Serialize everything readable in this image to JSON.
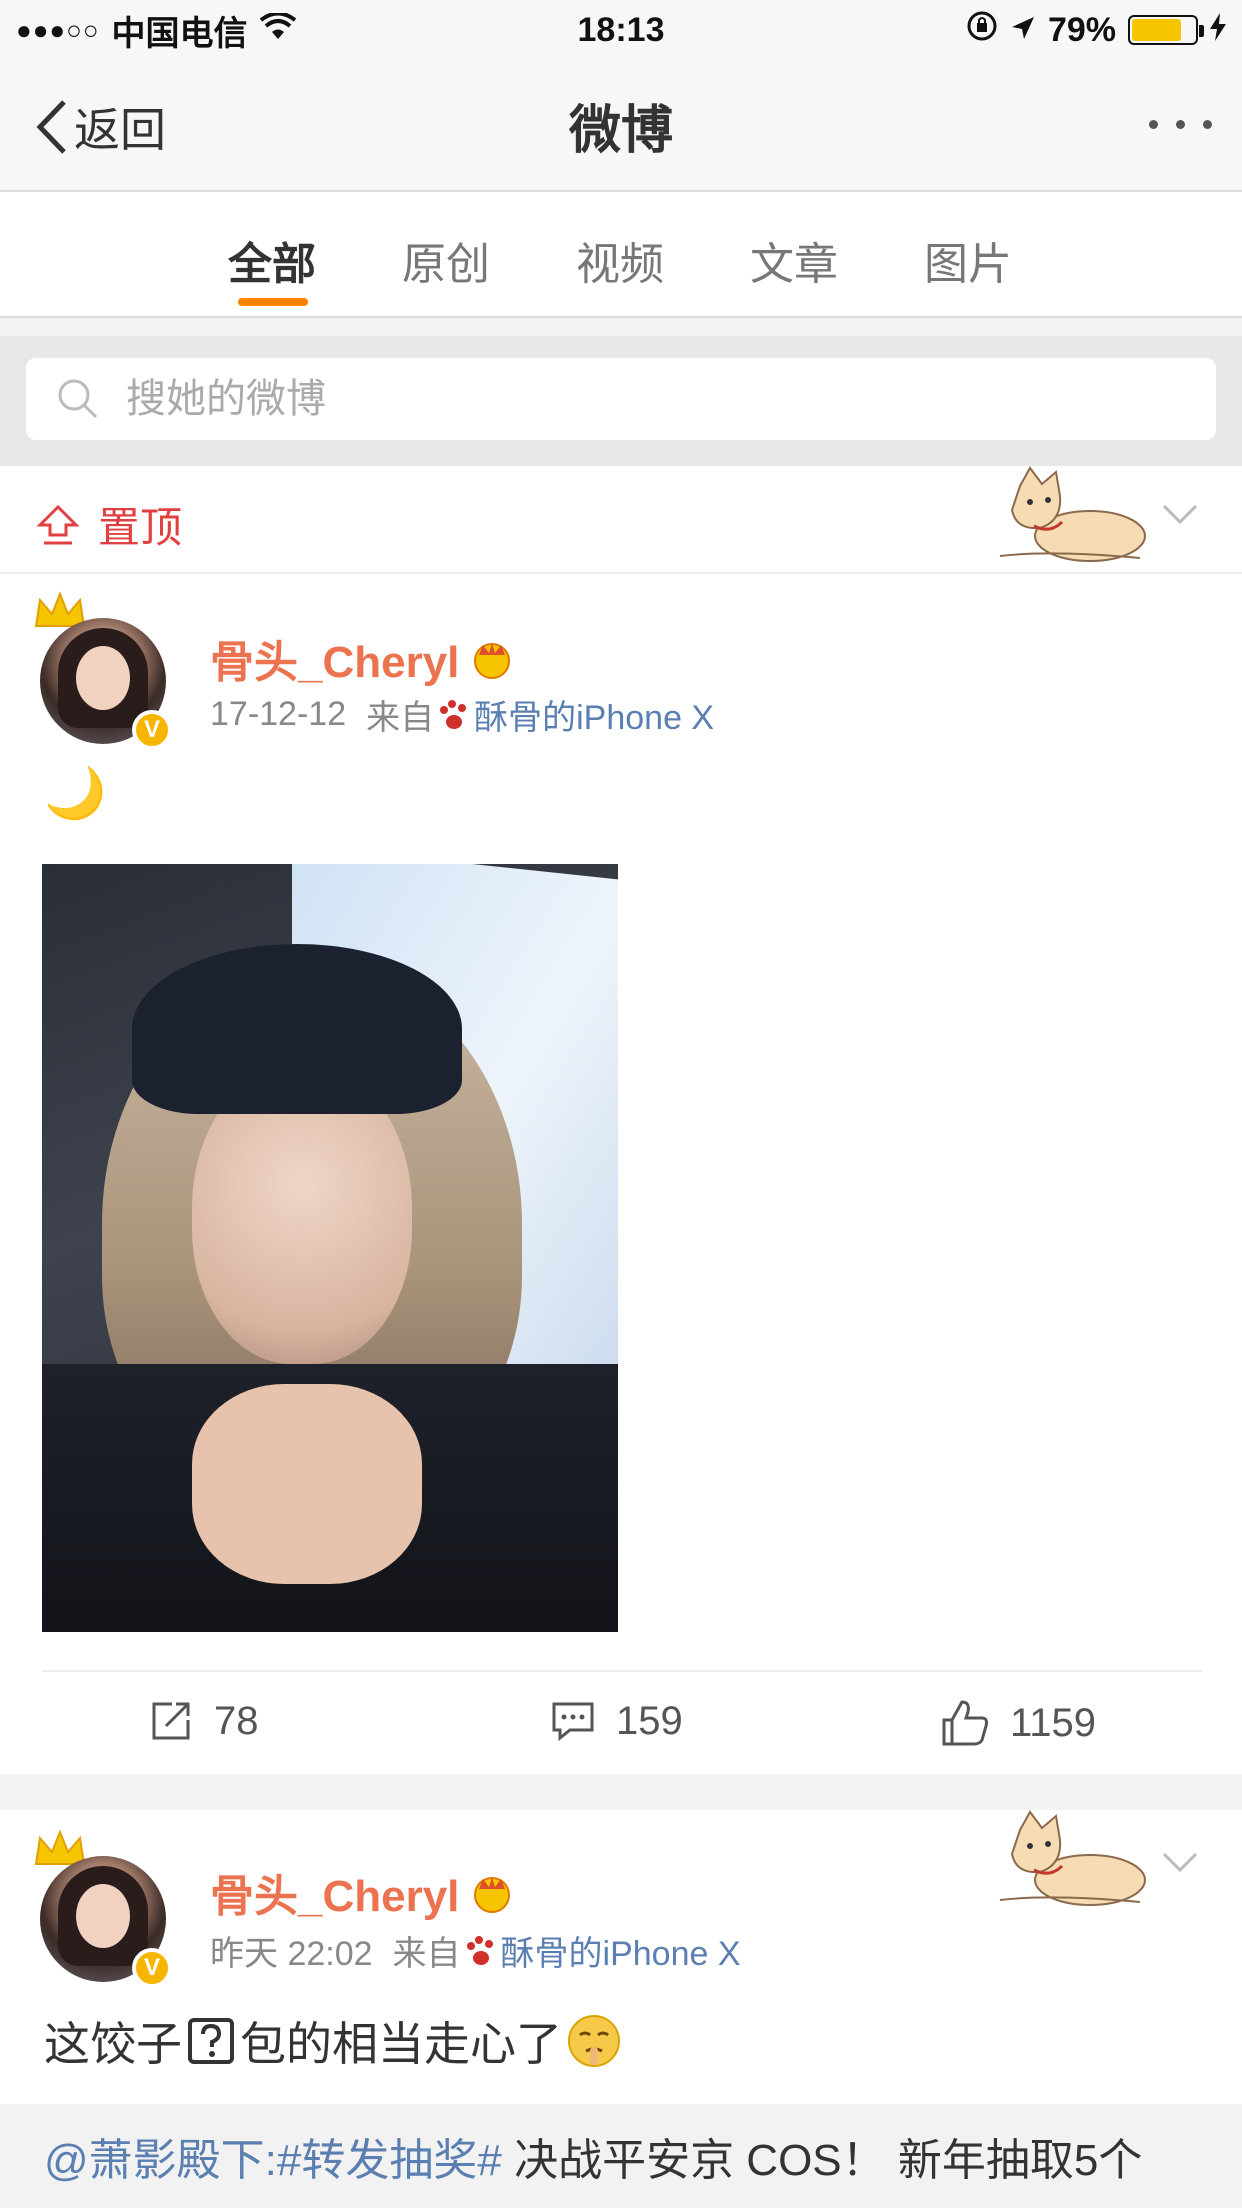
{
  "status_bar": {
    "signal": "●●●○○",
    "carrier": "中国电信",
    "time": "18:13",
    "battery": "79%",
    "battery_level": 0.79
  },
  "nav": {
    "back_label": "返回",
    "title": "微博"
  },
  "tabs": [
    {
      "label": "全部",
      "active": true
    },
    {
      "label": "原创",
      "active": false
    },
    {
      "label": "视频",
      "active": false
    },
    {
      "label": "文章",
      "active": false
    },
    {
      "label": "图片",
      "active": false
    }
  ],
  "search": {
    "placeholder": "搜她的微博"
  },
  "pinned": {
    "label": "置顶"
  },
  "posts": [
    {
      "user": "骨头_Cheryl",
      "date": "17-12-12",
      "source_prefix": "来自",
      "device": "酥骨的iPhone X",
      "text": "🌙",
      "reposts": "78",
      "comments": "159",
      "likes": "1159"
    },
    {
      "user": "骨头_Cheryl",
      "date": "昨天 22:02",
      "source_prefix": "来自",
      "device": "酥骨的iPhone X",
      "text": "这饺子",
      "text_after": "包的相当走心了",
      "retweet": {
        "mention": "@萧影殿下:#转发抽奖#",
        "text": " 决战平安京 COS！ 新年抽取5个"
      }
    }
  ],
  "colors": {
    "accent": "#ff8200",
    "username": "#eb7350",
    "link": "#5b7fb0",
    "pinned": "#e04040"
  }
}
